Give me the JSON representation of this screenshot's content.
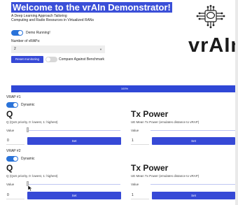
{
  "header": {
    "title": "Welcome to the vrAIn Demonstrator!",
    "subtitle_line1": "A Deep Learning Approach Tailoring",
    "subtitle_line2": "Computing and Radio Resources in Virtualized RANs",
    "demo_label": "Demo Running!",
    "num_vraps_label": "Number of vRAPs:",
    "num_vraps_value": "2",
    "reset_button": "Reset monitoring",
    "compare_label": "Compare Against Benchmark"
  },
  "logo": {
    "text": "vrAIn"
  },
  "progress": {
    "label": "100%",
    "value": 1.0
  },
  "vraps": [
    {
      "name": "VRAP #1",
      "dynamic_label": "Dynamic",
      "q_title": "Q",
      "q_desc": "Q (QoS priority, 0: lowest, 1: highest)",
      "q_value_label": "Value",
      "q_value": "0",
      "q_set": "Set",
      "tx_title": "Tx Power",
      "tx_desc": "UE Mean Tx Power (emulates distance to vRAP)",
      "tx_value_label": "Value",
      "tx_value": "1",
      "tx_set": "Set"
    },
    {
      "name": "VRAP #2",
      "dynamic_label": "Dynamic",
      "q_title": "Q",
      "q_desc": "Q (QoS priority, 0: lowest, 1: highest)",
      "q_value_label": "Value",
      "q_value": "0",
      "q_set": "Set",
      "tx_title": "Tx Power",
      "tx_desc": "UE Mean Tx Power (emulates distance to vRAP)",
      "tx_value_label": "Value",
      "tx_value": "1",
      "tx_set": "Set"
    }
  ],
  "icons": {
    "logo_icon": "brain-chip-icon",
    "cursor": "mouse-pointer-icon"
  },
  "colors": {
    "accent": "#3649d6",
    "toggle_on": "#2a73d9",
    "toggle_off": "#d8d8d8"
  }
}
